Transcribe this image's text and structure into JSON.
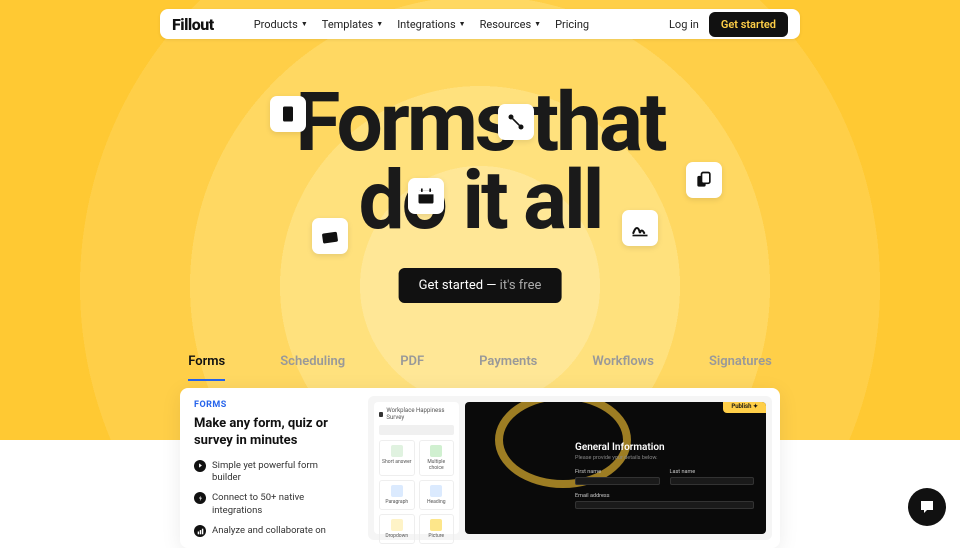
{
  "nav": {
    "logo": "Fillout",
    "links": [
      "Products",
      "Templates",
      "Integrations",
      "Resources",
      "Pricing"
    ],
    "login": "Log in",
    "cta": "Get started"
  },
  "hero": {
    "line1": "Forms that",
    "line2": "do it all"
  },
  "cta": {
    "main": "Get started — ",
    "free": "it's free"
  },
  "tabs": [
    "Forms",
    "Scheduling",
    "PDF",
    "Payments",
    "Workflows",
    "Signatures"
  ],
  "panel": {
    "tag": "FORMS",
    "title": "Make any form, quiz or survey in minutes",
    "features": [
      "Simple yet powerful form builder",
      "Connect to 50+ native integrations",
      "Analyze and collaborate on"
    ],
    "builder_header": "Workplace Happiness Survey",
    "blocks": [
      "Short answer",
      "Multiple choice",
      "Paragraph",
      "Heading",
      "Dropdown",
      "Picture"
    ],
    "publish": "Publish ✦",
    "form": {
      "title": "General Information",
      "sub": "Please provide your details below.",
      "fields": [
        "First name",
        "Last name",
        "Email address"
      ]
    }
  }
}
